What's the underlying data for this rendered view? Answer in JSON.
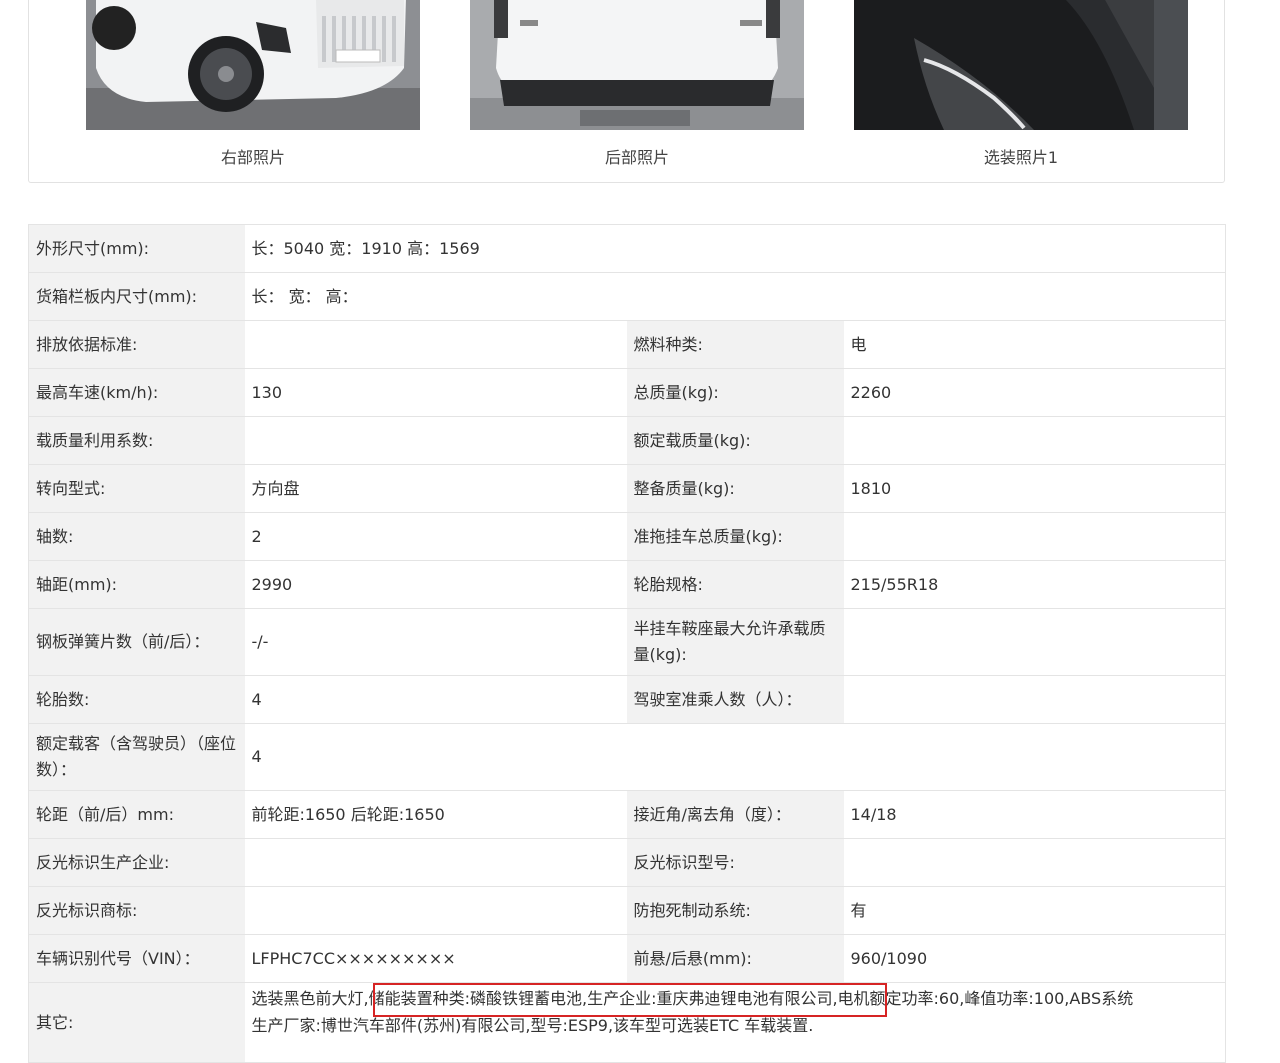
{
  "photos": [
    {
      "caption": "右部照片",
      "icon": "car-right-view"
    },
    {
      "caption": "后部照片",
      "icon": "car-rear-view"
    },
    {
      "caption": "选装照片1",
      "icon": "car-headlight-detail"
    }
  ],
  "specs": {
    "dimensions": {
      "label": "外形尺寸(mm):",
      "value": "长：5040 宽：1910 高：1569"
    },
    "cargo_box": {
      "label": "货箱栏板内尺寸(mm):",
      "value": "长： 宽： 高："
    },
    "rows": [
      {
        "l1": "排放依据标准:",
        "v1": "",
        "l2": "燃料种类:",
        "v2": "电"
      },
      {
        "l1": "最高车速(km/h):",
        "v1": "130",
        "l2": "总质量(kg):",
        "v2": "2260"
      },
      {
        "l1": "载质量利用系数:",
        "v1": "",
        "l2": "额定载质量(kg):",
        "v2": ""
      },
      {
        "l1": "转向型式:",
        "v1": "方向盘",
        "l2": "整备质量(kg):",
        "v2": "1810"
      },
      {
        "l1": "轴数:",
        "v1": "2",
        "l2": "准拖挂车总质量(kg):",
        "v2": ""
      },
      {
        "l1": "轴距(mm):",
        "v1": "2990",
        "l2": "轮胎规格:",
        "v2": "215/55R18"
      },
      {
        "l1": "钢板弹簧片数（前/后）：",
        "v1": "-/-",
        "l2": "半挂车鞍座最大允许承载质量(kg):",
        "v2": ""
      },
      {
        "l1": "轮胎数:",
        "v1": "4",
        "l2": "驾驶室准乘人数（人）：",
        "v2": ""
      }
    ],
    "seats": {
      "label": "额定载客（含驾驶员）（座位数）：",
      "value": "4"
    },
    "rows2": [
      {
        "l1": "轮距（前/后）mm:",
        "v1": "前轮距:1650 后轮距:1650",
        "l2": "接近角/离去角（度）：",
        "v2": "14/18"
      },
      {
        "l1": "反光标识生产企业:",
        "v1": "",
        "l2": "反光标识型号:",
        "v2": ""
      },
      {
        "l1": "反光标识商标:",
        "v1": "",
        "l2": "防抱死制动系统:",
        "v2": "有"
      },
      {
        "l1": "车辆识别代号（VIN）：",
        "v1": "LFPHC7CC×××××××××",
        "l2": "前悬/后悬(mm):",
        "v2": "960/1090"
      }
    ],
    "other": {
      "label": "其它:",
      "line1": "选装黑色前大灯,储能装置种类:磷酸铁锂蓄电池,生产企业:重庆弗迪锂电池有限公司,电机额定功率:60,峰值功率:100,ABS系统",
      "line2": "生产厂家:博世汽车部件(苏州)有限公司,型号:ESP9,该车型可选装ETC 车载装置."
    }
  },
  "colors": {
    "label_bg": "#f2f2f2",
    "border": "#e4e4e4",
    "highlight": "#d62424"
  }
}
